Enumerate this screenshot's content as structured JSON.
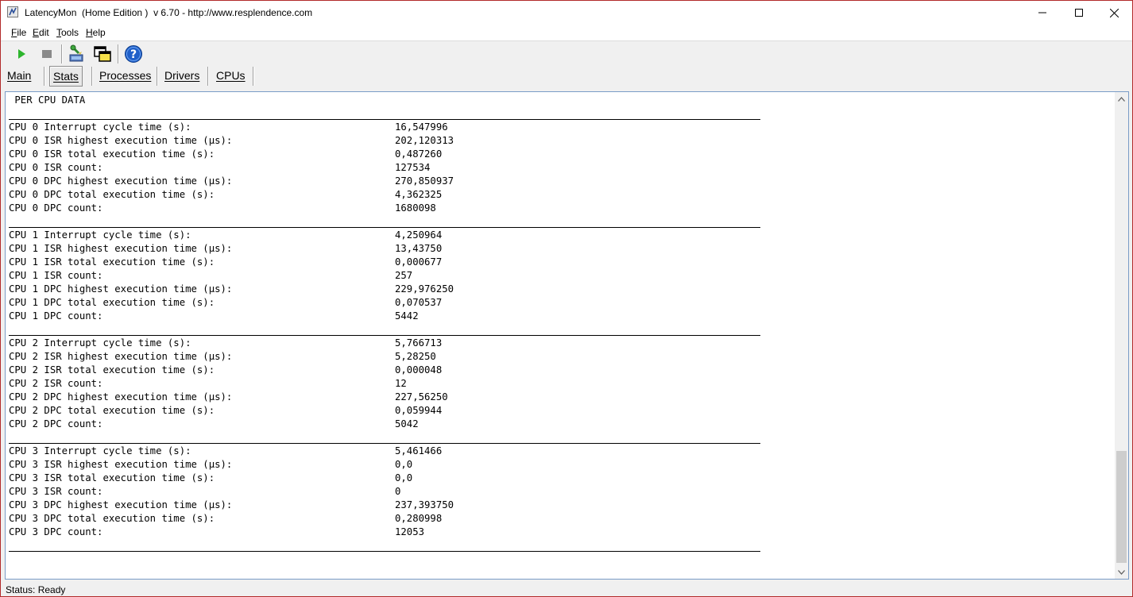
{
  "window": {
    "title": "LatencyMon  (Home Edition )  v 6.70 - http://www.resplendence.com"
  },
  "menu": [
    {
      "underline": "F",
      "rest": "ile"
    },
    {
      "underline": "E",
      "rest": "dit"
    },
    {
      "underline": "T",
      "rest": "ools"
    },
    {
      "underline": "H",
      "rest": "elp"
    }
  ],
  "toolbar": {
    "icons": [
      "play-icon",
      "stop-icon",
      "kernel-icon",
      "windows-icon",
      "help-icon"
    ],
    "colors": {
      "play": "#2db52d",
      "stop": "#8a8a8a",
      "help": "#1f5fc9"
    }
  },
  "tabs": [
    {
      "label": "Main"
    },
    {
      "label": "Stats"
    },
    {
      "label": "Processes"
    },
    {
      "label": "Drivers"
    },
    {
      "label": "CPUs"
    }
  ],
  "content": {
    "section_title": " PER CPU DATA",
    "cpus": [
      {
        "rows": [
          {
            "label": "CPU 0 Interrupt cycle time (s):",
            "value": "16,547996"
          },
          {
            "label": "CPU 0 ISR highest execution time (µs):",
            "value": "202,120313"
          },
          {
            "label": "CPU 0 ISR total execution time (s):",
            "value": "0,487260"
          },
          {
            "label": "CPU 0 ISR count:",
            "value": "127534"
          },
          {
            "label": "CPU 0 DPC highest execution time (µs):",
            "value": "270,850937"
          },
          {
            "label": "CPU 0 DPC total execution time (s):",
            "value": "4,362325"
          },
          {
            "label": "CPU 0 DPC count:",
            "value": "1680098"
          }
        ]
      },
      {
        "rows": [
          {
            "label": "CPU 1 Interrupt cycle time (s):",
            "value": "4,250964"
          },
          {
            "label": "CPU 1 ISR highest execution time (µs):",
            "value": "13,43750"
          },
          {
            "label": "CPU 1 ISR total execution time (s):",
            "value": "0,000677"
          },
          {
            "label": "CPU 1 ISR count:",
            "value": "257"
          },
          {
            "label": "CPU 1 DPC highest execution time (µs):",
            "value": "229,976250"
          },
          {
            "label": "CPU 1 DPC total execution time (s):",
            "value": "0,070537"
          },
          {
            "label": "CPU 1 DPC count:",
            "value": "5442"
          }
        ]
      },
      {
        "rows": [
          {
            "label": "CPU 2 Interrupt cycle time (s):",
            "value": "5,766713"
          },
          {
            "label": "CPU 2 ISR highest execution time (µs):",
            "value": "5,28250"
          },
          {
            "label": "CPU 2 ISR total execution time (s):",
            "value": "0,000048"
          },
          {
            "label": "CPU 2 ISR count:",
            "value": "12"
          },
          {
            "label": "CPU 2 DPC highest execution time (µs):",
            "value": "227,56250"
          },
          {
            "label": "CPU 2 DPC total execution time (s):",
            "value": "0,059944"
          },
          {
            "label": "CPU 2 DPC count:",
            "value": "5042"
          }
        ]
      },
      {
        "rows": [
          {
            "label": "CPU 3 Interrupt cycle time (s):",
            "value": "5,461466"
          },
          {
            "label": "CPU 3 ISR highest execution time (µs):",
            "value": "0,0"
          },
          {
            "label": "CPU 3 ISR total execution time (s):",
            "value": "0,0"
          },
          {
            "label": "CPU 3 ISR count:",
            "value": "0"
          },
          {
            "label": "CPU 3 DPC highest execution time (µs):",
            "value": "237,393750"
          },
          {
            "label": "CPU 3 DPC total execution time (s):",
            "value": "0,280998"
          },
          {
            "label": "CPU 3 DPC count:",
            "value": "12053"
          }
        ]
      }
    ]
  },
  "status": {
    "text": "Status: Ready"
  }
}
